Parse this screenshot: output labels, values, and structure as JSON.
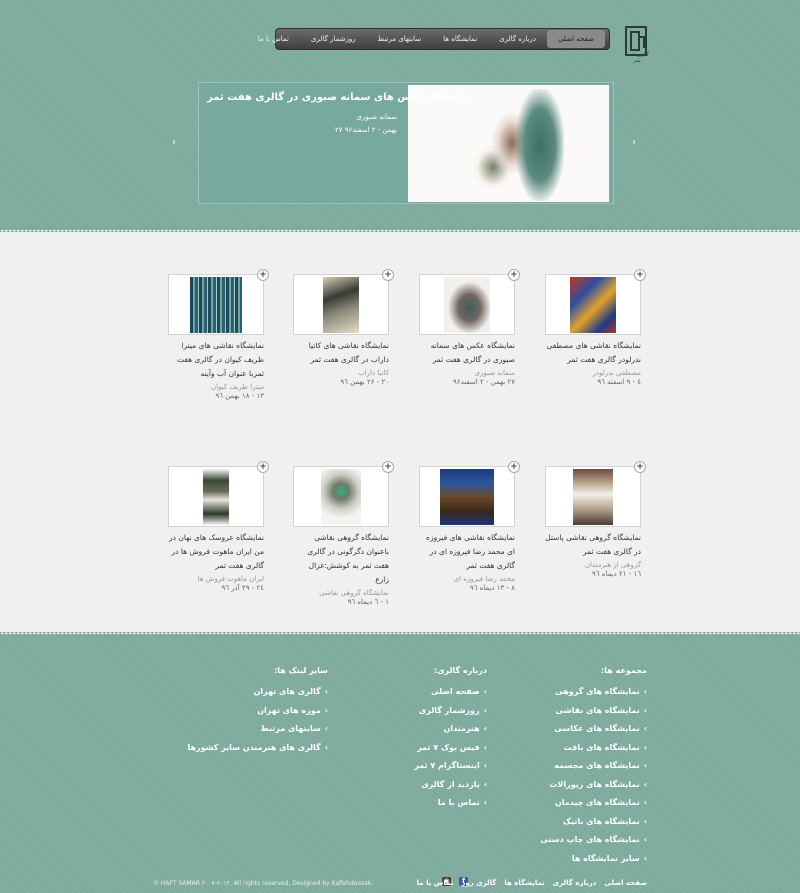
{
  "header": {
    "logo_text": "گالری هفت ثمر",
    "nav": [
      {
        "label": "صفحه اصلی"
      },
      {
        "label": "درباره گالری"
      },
      {
        "label": "نمایشگاه ها"
      },
      {
        "label": "سایتهای مرتبط"
      },
      {
        "label": "روزشمار گالری"
      },
      {
        "label": "تماس با ما"
      }
    ]
  },
  "slider": {
    "title": "نمایشگاه عکس های سمانه صبوری در گالری هفت ثمر",
    "artist": "سمانه صبوری",
    "date": "۲۷ بهمن - ۲ اسفند۹۶",
    "prev": "‹",
    "next": "›"
  },
  "exhibitions": [
    {
      "title": "نمایشگاه نقاشی های مصطفی ندرلودر گالری هفت ثمر",
      "artist": "مصطفی ندرلودر",
      "date": "٤ - ٩ اسفند ٩٦"
    },
    {
      "title": "نمایشگاه عکس های سمانه صبوری در گالری هفت ثمر",
      "artist": "سمانه صبوری",
      "date": "۲۷ بهمن - ۲ اسفند۹۶"
    },
    {
      "title": "نمایشگاه نقاشی های کاتیا داراب در گالری هفت ثمر",
      "artist": "کاتیا داراب",
      "date": "۲۰ - ۲۶ بهمن ۹٦"
    },
    {
      "title": "نمایشگاه نقاشی های میترا ظریف کیوان در گالری هفت ثمربا عنوان آب وآینه",
      "artist": "میترا ظریف کیوان",
      "date": "۱۳ - ۱۸ بهمن ۹٦"
    },
    {
      "title": "نمایشگاه گروهی نقاشی پاستل در گالری هفت ثمر",
      "artist": "گروهی از هنرمندان",
      "date": "۱٦ - ۲۱ دیماه ۹٦"
    },
    {
      "title": "نمایشگاه نقاشی های فیروزه ای محمد رضا فیروزه ای در گالری هفت ثمر",
      "artist": "محمد رضا فیروزه ای",
      "date": "۸ - ۱۳ دیماه ۹٦"
    },
    {
      "title": "نمایشگاه گروهی نقاشی باعنوان دگرگونی در گالری هفت ثمر به کوشش:غزال زارع",
      "artist": "نمایشگاه گروهی نقاشی",
      "date": "۱ - ٦ دیماه ۹٦"
    },
    {
      "title": "نمایشگاه عروسک های نهان در من ایران ماهوت فروش ها در گالری هفت ثمر",
      "artist": "ایران ماهوت فروش ها",
      "date": "۲٤ - ۲۹ آذر ۹٦"
    }
  ],
  "footer": {
    "collections": {
      "title": "مجموعه ها:",
      "items": [
        "نمایشگاه های گروهی",
        "نمایشگاه های نقاشی",
        "نمایشگاه های عکاسی",
        "نمایشگاه های بافت",
        "نمایشگاه های مجسمه",
        "نمایشگاه های زیورالات",
        "نمایشگاه های چیدمان",
        "نمایشگاه های باتیک",
        "نمایشگاه های چاپ دستی",
        "سایر نمایشگاه ها"
      ]
    },
    "about": {
      "title": "درباره گالری:",
      "items": [
        "صفحه اصلی",
        "روزشمار گالری",
        "هنرمندان",
        "فیس بوک ۷ ثمر",
        "اینستاگرام ۷ ثمر",
        "بازدید از گالری",
        "تماس با ما"
      ]
    },
    "links": {
      "title": "سایر لینک ها:",
      "items": [
        "گالری های تهران",
        "موزه های تهران",
        "سایتهای مرتبط",
        "گالری های هنرمندن سایر کشورها"
      ]
    },
    "copyright": "© HAFT SAMAR ۲۰۰۷-۲۰۱۳, All rights reserved, Designed by Kafishdoozak.",
    "bottom_nav": [
      "صفحه اصلی",
      "درباره گالری",
      "نمایشگاه ها",
      "گالری روز",
      "تماس با ما"
    ],
    "social": {
      "facebook": "f",
      "instagram": "◉"
    }
  }
}
